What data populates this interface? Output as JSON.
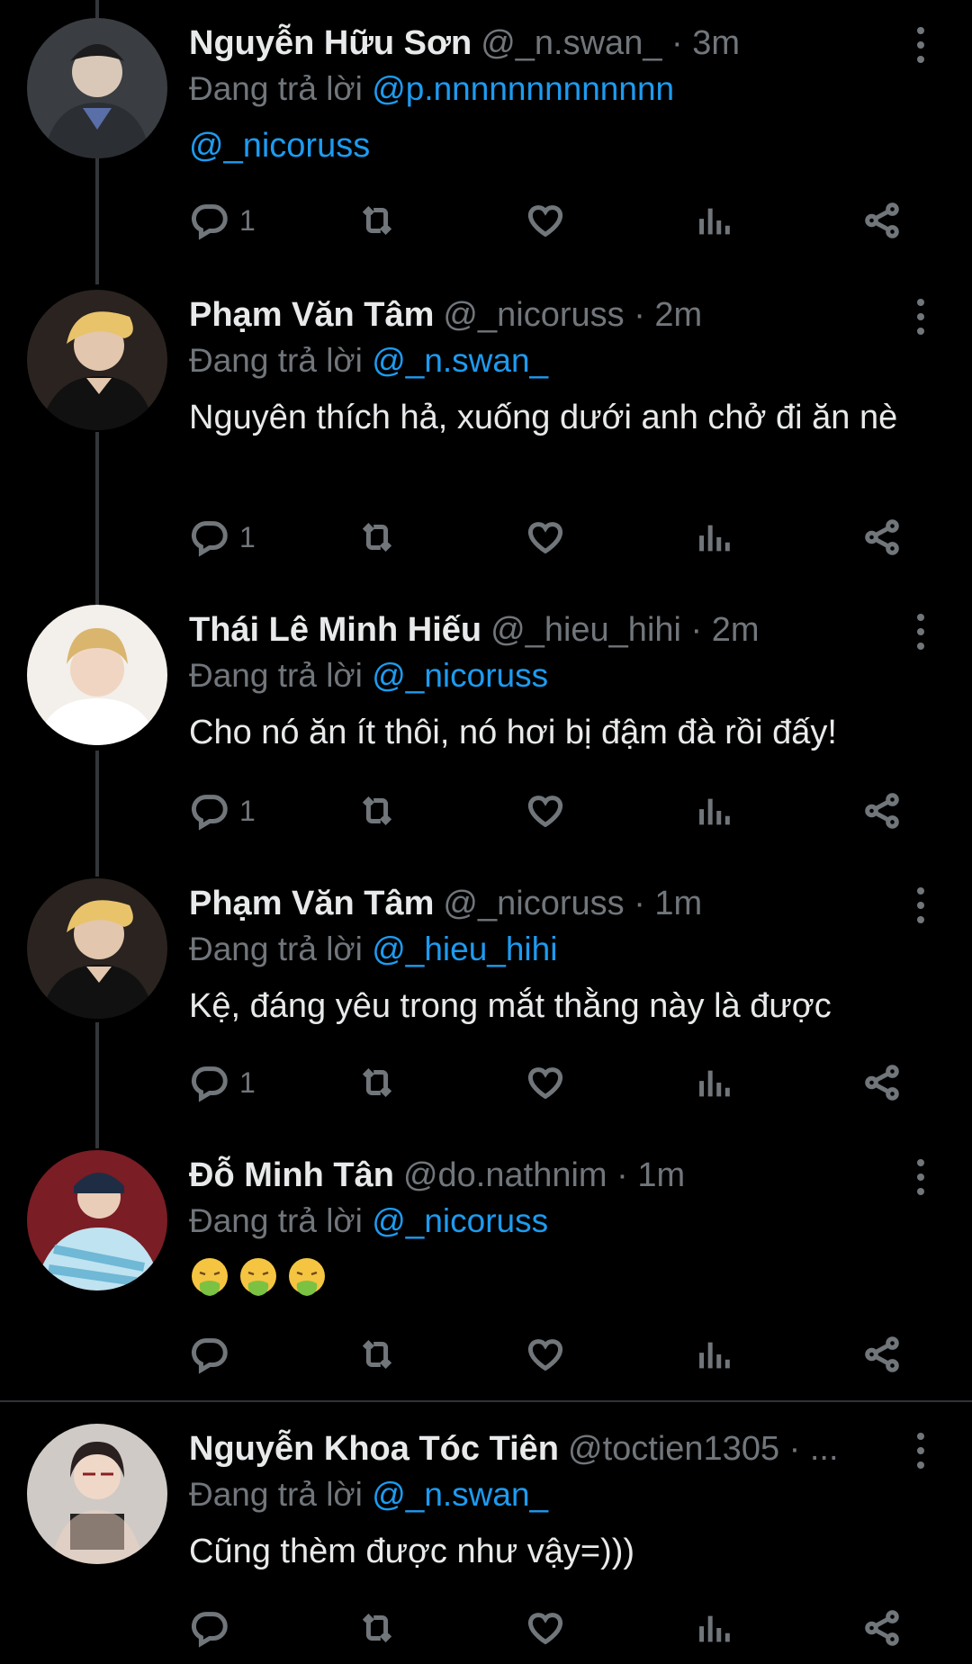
{
  "reply_prefix": "Đang trả lời",
  "tweets": [
    {
      "name": "Nguyễn Hữu Sơn",
      "handle": "@_n.swan_",
      "time": "3m",
      "reply_to": "@p.nnnnnnnnnnnnn",
      "text": "@_nicoruss",
      "reply_count": "1"
    },
    {
      "name": "Phạm Văn Tâm",
      "handle": "@_nicoruss",
      "time": "2m",
      "reply_to": "@_n.swan_",
      "text": "Nguyên thích hả, xuống dưới anh chở đi ăn nè",
      "reply_count": "1"
    },
    {
      "name": "Thái Lê Minh Hiếu",
      "handle": "@_hieu_hihi",
      "time": "2m",
      "reply_to": "@_nicoruss",
      "text": "Cho nó ăn ít thôi, nó hơi bị đậm đà rồi đấy!",
      "reply_count": "1"
    },
    {
      "name": "Phạm Văn Tâm",
      "handle": "@_nicoruss",
      "time": "1m",
      "reply_to": "@_hieu_hihi",
      "text": "Kệ, đáng yêu trong mắt thằng này là được",
      "reply_count": "1"
    },
    {
      "name": "Đỗ Minh Tân",
      "handle": "@do.nathnim",
      "time": "1m",
      "reply_to": "@_nicoruss",
      "text": "🤮🤮🤮",
      "reply_count": ""
    },
    {
      "name": "Nguyễn Khoa Tóc Tiên",
      "handle": "@toctien1305",
      "time": "...",
      "reply_to": "@_n.swan_",
      "text": "Cũng thèm được như vậy=)))",
      "reply_count": ""
    }
  ],
  "colors": {
    "background": "#000000",
    "mention": "#1d9bf0",
    "secondary_text": "#71767b",
    "thread_line": "#333639"
  },
  "icons": [
    "reply-icon",
    "retweet-icon",
    "like-icon",
    "views-icon",
    "share-icon",
    "more-icon",
    "vomit-emoji-icon"
  ]
}
